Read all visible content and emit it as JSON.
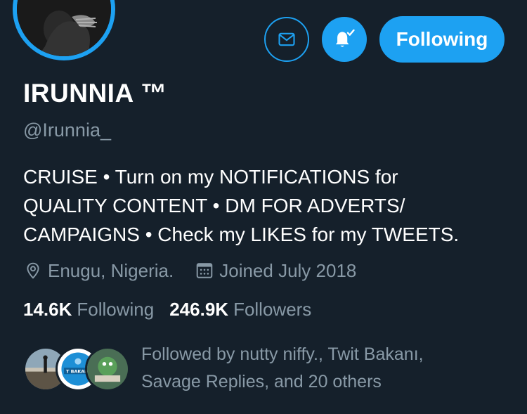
{
  "header": {
    "following_label": "Following"
  },
  "profile": {
    "name": "IRUNNIA ™",
    "handle": "@Irunnia_",
    "bio": [
      "CRUISE • Turn on my NOTIFICATIONS for",
      "QUALITY CONTENT • DM FOR ADVERTS/",
      "CAMPAIGNS • Check my LIKES for my TWEETS."
    ],
    "location": "Enugu, Nigeria.",
    "joined": "Joined July 2018",
    "following_count": "14.6K",
    "following_label": "Following",
    "followers_count": "246.9K",
    "followers_label": "Followers",
    "followed_by": [
      "Followed by nutty niffy., Twit Bakanı,",
      "Savage Replies, and 20 others"
    ],
    "badge_text": "T BAKANI"
  },
  "icons": {
    "message": "mail-icon",
    "notifications": "bell-check-icon",
    "location": "location-pin-icon",
    "joined": "calendar-icon"
  },
  "colors": {
    "background": "#15202b",
    "accent": "#1da1f2",
    "secondary_text": "#8899a6",
    "primary_text": "#ffffff"
  }
}
